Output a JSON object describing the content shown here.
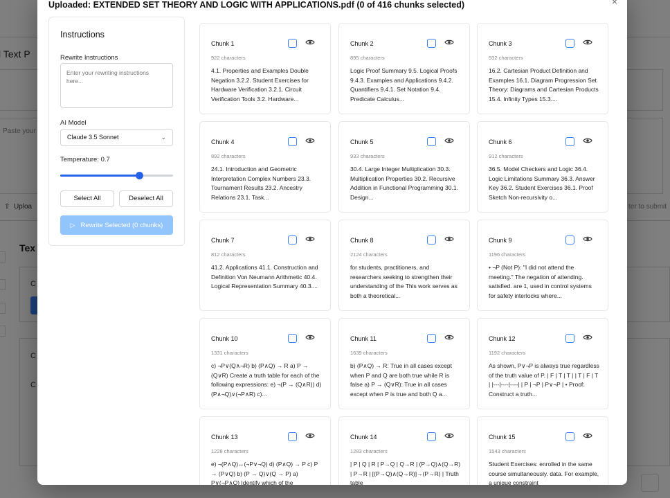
{
  "background": {
    "left_title": "l Text P",
    "paste_placeholder": "Paste your",
    "upload_label": "Uploa",
    "section_title": "Tex",
    "hint": "ter to submit",
    "c_label_1": "C",
    "c_label_2": "C",
    "c_label_3": "C"
  },
  "modal": {
    "title": "Uploaded: EXTENDED SET THEORY AND LOGIC WITH APPLICATIONS.pdf (0 of 416 chunks selected)",
    "close_glyph": "×"
  },
  "instructions": {
    "title": "Instructions",
    "rewrite_label": "Rewrite Instructions",
    "rewrite_placeholder": "Enter your rewriting instructions here...",
    "model_label": "AI Model",
    "model_value": "Claude 3.5 Sonnet",
    "temperature_label": "Temperature: 0.7",
    "temperature_value": 0.7,
    "select_all": "Select All",
    "deselect_all": "Deselect All",
    "rewrite_button": "Rewrite Selected (0 chunks)"
  },
  "colors": {
    "accent": "#2563eb",
    "primary_disabled": "#93c5fd",
    "checkbox_border": "#3b82f6"
  },
  "chunks": [
    {
      "title": "Chunk 1",
      "chars": "922 characters",
      "text": "4.1. Properties and Examples Double Negation 3.2.2. Student Exercises for Hardware Verification 3.2.1. Circuit Verification Tools 3.2. Hardware..."
    },
    {
      "title": "Chunk 2",
      "chars": "895 characters",
      "text": "Logic Proof Summary 9.5. Logical Proofs 9.4.3. Examples and Applications 9.4.2. Quantifiers 9.4.1. Set Notation 9.4. Predicate Calculus..."
    },
    {
      "title": "Chunk 3",
      "chars": "932 characters",
      "text": "16.2. Cartesian Product Definition and Examples 16.1. Diagram Progression Set Theory: Diagrams and Cartesian Products 15.4. Infinity Types 15.3...."
    },
    {
      "title": "Chunk 4",
      "chars": "892 characters",
      "text": "24.1. Introduction and Geometric Interpretation Complex Numbers 23.3. Tournament Results 23.2. Ancestry Relations 23.1. Task..."
    },
    {
      "title": "Chunk 5",
      "chars": "933 characters",
      "text": "30.4. Large Integer Multiplication 30.3. Multiplication Properties 30.2. Recursive Addition in Functional Programming 30.1. Design..."
    },
    {
      "title": "Chunk 6",
      "chars": "912 characters",
      "text": "36.5. Model Checkers and Logic 36.4. Logic Limitations Summary 36.3. Answer Key 36.2. Student Exercises 36.1. Proof Sketch Non-recursivity o..."
    },
    {
      "title": "Chunk 7",
      "chars": "812 characters",
      "text": "41.2. Applications 41.1. Construction and Definition Von Neumann Arithmetic 40.4. Logical Representation Summary 40.3...."
    },
    {
      "title": "Chunk 8",
      "chars": "2124 characters",
      "text": "for students, practitioners, and researchers seeking to strengthen their understanding of the This work serves as both a theoretical..."
    },
    {
      "title": "Chunk 9",
      "chars": "1196 characters",
      "text": "• ¬P (Not P): \"I did not attend the meeting.\" The negation of attending. satisfied. are 1, used in control systems for safety interlocks where..."
    },
    {
      "title": "Chunk 10",
      "chars": "1331 characters",
      "text": "c) ¬P∨(Q∧¬R) b) (P∧Q) → R a) P → (Q∨R) Create a truth table for each of the following expressions: e) ¬(P → (Q∧R)) d) (P∧¬Q)∨(¬P∧R) c)..."
    },
    {
      "title": "Chunk 11",
      "chars": "1639 characters",
      "text": "b) (P∧Q) → R: True in all cases except when P and Q are both true while R is false a) P → (Q∨R): True in all cases except when P is true and both Q a..."
    },
    {
      "title": "Chunk 12",
      "chars": "1192 characters",
      "text": "As shown, P∨¬P is always true regardless of the truth value of P. | F | T | T | | T | F | T | |---|----|----| | P | ¬P | P∨¬P | • Proof: Construct a truth..."
    },
    {
      "title": "Chunk 13",
      "chars": "1228 characters",
      "text": "e) ¬(P∧Q)↔(¬P∨¬Q) d) (P∧Q) → P c) P → (P∨Q) b) (P → Q)∨(Q → P) a) P∨(¬P∧Q) Identify which of the"
    },
    {
      "title": "Chunk 14",
      "chars": "1283 characters",
      "text": "| P | Q | R | P→Q | Q→R | (P→Q)∧(Q→R) | P→R | [(P→Q)∧(Q→R)]→(P→R) | Truth table"
    },
    {
      "title": "Chunk 15",
      "chars": "1543 characters",
      "text": "Student Exercises: enrolled in the same course simultaneously. data. For example, a unique constraint"
    }
  ]
}
